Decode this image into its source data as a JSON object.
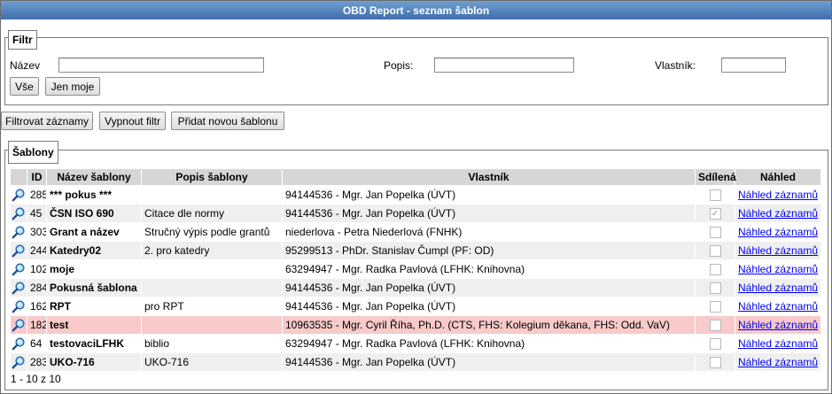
{
  "window": {
    "title": "OBD Report - seznam šablon"
  },
  "filter": {
    "legend": "Filtr",
    "name_label": "Název",
    "name_value": "",
    "desc_label": "Popis:",
    "desc_value": "",
    "owner_label": "Vlastník:",
    "owner_value": "",
    "all_button": "Vše",
    "mine_button": "Jen moje"
  },
  "toolbar": {
    "filter_button": "Filtrovat záznamy",
    "off_button": "Vypnout filtr",
    "add_button": "Přidat novou šablonu"
  },
  "templates": {
    "legend": "Šablony",
    "columns": {
      "id": "ID",
      "name": "Název šablony",
      "desc": "Popis šablony",
      "owner": "Vlastník",
      "shared": "Sdílená",
      "preview": "Náhled"
    },
    "rows": [
      {
        "id": "285",
        "name": "*** pokus ***",
        "desc": "",
        "owner": "94144536 - Mgr. Jan Popelka (ÚVT)",
        "shared": false,
        "preview": "Náhled záznamů",
        "highlight": false
      },
      {
        "id": "45",
        "name": "ČSN ISO 690",
        "desc": "Citace dle normy",
        "owner": "94144536 - Mgr. Jan Popelka (ÚVT)",
        "shared": true,
        "preview": "Náhled záznamů",
        "highlight": false
      },
      {
        "id": "303",
        "name": "Grant a název",
        "desc": "Stručný výpis podle grantů",
        "owner": "niederlova - Petra Niederlová (FNHK)",
        "shared": false,
        "preview": "Náhled záznamů",
        "highlight": false
      },
      {
        "id": "244",
        "name": "Katedry02",
        "desc": "2. pro katedry",
        "owner": "95299513 - PhDr. Stanislav Čumpl (PF: OD)",
        "shared": false,
        "preview": "Náhled záznamů",
        "highlight": false
      },
      {
        "id": "102",
        "name": "moje",
        "desc": "",
        "owner": "63294947 - Mgr. Radka Pavlová (LFHK: Knihovna)",
        "shared": false,
        "preview": "Náhled záznamů",
        "highlight": false
      },
      {
        "id": "284",
        "name": "Pokusná šablona",
        "desc": "",
        "owner": "94144536 - Mgr. Jan Popelka (ÚVT)",
        "shared": false,
        "preview": "Náhled záznamů",
        "highlight": false
      },
      {
        "id": "162",
        "name": "RPT",
        "desc": "pro RPT",
        "owner": "94144536 - Mgr. Jan Popelka (ÚVT)",
        "shared": false,
        "preview": "Náhled záznamů",
        "highlight": false
      },
      {
        "id": "182",
        "name": "test",
        "desc": "",
        "owner": "10963535 - Mgr. Cyril Říha, Ph.D. (CTS, FHS: Kolegium děkana, FHS: Odd. VaV)",
        "shared": false,
        "preview": "Náhled záznamů",
        "highlight": true
      },
      {
        "id": "64",
        "name": "testovaciLFHK",
        "desc": "biblio",
        "owner": "63294947 - Mgr. Radka Pavlová (LFHK: Knihovna)",
        "shared": false,
        "preview": "Náhled záznamů",
        "highlight": false
      },
      {
        "id": "283",
        "name": "UKO-716",
        "desc": "UKO-716",
        "owner": "94144536 - Mgr. Jan Popelka (ÚVT)",
        "shared": false,
        "preview": "Náhled záznamů",
        "highlight": false
      }
    ],
    "pager": "1 - 10 z 10"
  }
}
